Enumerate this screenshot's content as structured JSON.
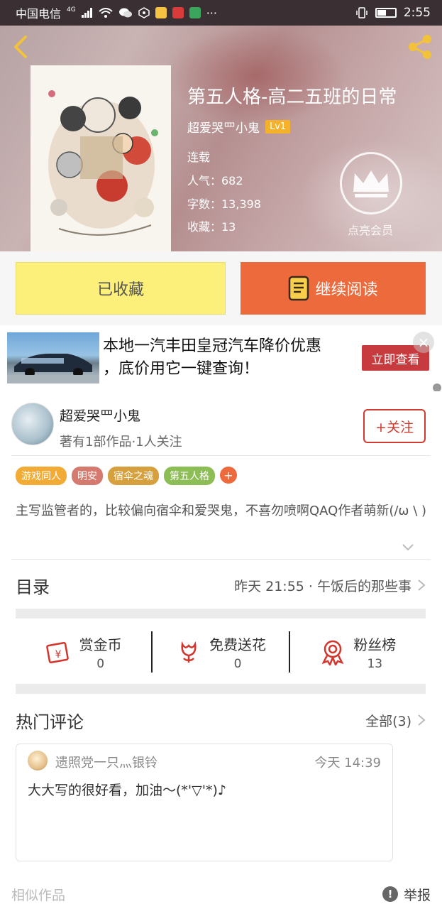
{
  "status_bar": {
    "carrier": "中国电信",
    "network": "4G",
    "time": "2:55",
    "app_icons": [
      "signal-icon",
      "wifi-icon",
      "wechat-icon",
      "app-icon-1",
      "app-icon-2",
      "app-icon-3",
      "app-icon-4"
    ],
    "more": "···"
  },
  "book": {
    "title": "第五人格-高二五班的日常",
    "author": "超爱哭罒小鬼",
    "level": "Lv1",
    "status": "连载",
    "popularity": "人气：682",
    "word_count": "字数：13,398",
    "favorites": "收藏：13",
    "vip_label": "点亮会员"
  },
  "actions": {
    "collected_label": "已收藏",
    "continue_label": "继续阅读"
  },
  "ad": {
    "line1": "本地一汽丰田皇冠汽车降价优惠",
    "line2": "，底价用它一键查询！",
    "button": "立即查看",
    "close": "×"
  },
  "author_section": {
    "name": "超爱哭罒小鬼",
    "summary": "著有1部作品·1人关注",
    "follow": "+关注",
    "tags": [
      {
        "label": "游戏同人",
        "color": "#f2ac35"
      },
      {
        "label": "明安",
        "color": "#d57a6e"
      },
      {
        "label": "宿伞之魂",
        "color": "#d6a03e"
      },
      {
        "label": "第五人格",
        "color": "#8dbd55"
      }
    ],
    "tag_add": "+",
    "description": "主写监管者的，比较偏向宿伞和爱哭鬼，不喜勿喷啊QAQ作者萌新(/ω \\ )"
  },
  "toc": {
    "title": "目录",
    "latest": "昨天 21:55 · 午饭后的那些事"
  },
  "stats": [
    {
      "label": "赏金币",
      "value": "0",
      "icon": "reward-coin-icon"
    },
    {
      "label": "免费送花",
      "value": "0",
      "icon": "flower-icon"
    },
    {
      "label": "粉丝榜",
      "value": "13",
      "icon": "fan-ribbon-icon"
    }
  ],
  "comments": {
    "title": "热门评论",
    "all": "全部(3)",
    "items": [
      {
        "user": "遗照党一只灬银铃",
        "time": "今天 14:39",
        "text": "大大写的很好看，加油～(*'▽'*)♪"
      }
    ]
  },
  "footer": {
    "similar": "相似作品",
    "report": "举报",
    "report_icon": "!"
  },
  "colors": {
    "accent": "#ec6a3c",
    "collected_bg": "#fcf07a",
    "follow_red": "#cf3b30"
  }
}
